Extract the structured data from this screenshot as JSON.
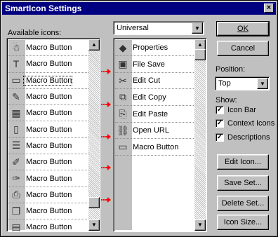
{
  "window": {
    "title": "SmartIcon Settings",
    "close_glyph": "×"
  },
  "available": {
    "label": "Available icons:",
    "items": [
      {
        "icon": "macro-figure-icon",
        "label": "Macro Button"
      },
      {
        "icon": "macro-text-icon",
        "label": "Macro Button"
      },
      {
        "icon": "macro-window-icon",
        "label": "Macro Button"
      },
      {
        "icon": "macro-pen-icon",
        "label": "Macro Button"
      },
      {
        "icon": "macro-grid-icon",
        "label": "Macro Button"
      },
      {
        "icon": "macro-page-icon",
        "label": "Macro Button"
      },
      {
        "icon": "macro-lines-icon",
        "label": "Macro Button"
      },
      {
        "icon": "macro-brush-icon",
        "label": "Macro Button"
      },
      {
        "icon": "macro-brush2-icon",
        "label": "Macro Button"
      },
      {
        "icon": "macro-printer-icon",
        "label": "Macro Button"
      },
      {
        "icon": "macro-copies-icon",
        "label": "Macro Button"
      },
      {
        "icon": "macro-doc-icon",
        "label": "Macro Button"
      }
    ]
  },
  "set_dropdown": {
    "value": "Universal"
  },
  "current": {
    "items": [
      {
        "icon": "properties-icon",
        "label": "Properties"
      },
      {
        "icon": "file-save-icon",
        "label": "File Save"
      },
      {
        "icon": "scissors-icon",
        "label": "Edit Cut"
      },
      {
        "icon": "copy-icon",
        "label": "Edit Copy"
      },
      {
        "icon": "paste-icon",
        "label": "Edit Paste"
      },
      {
        "icon": "url-icon",
        "label": "Open URL"
      },
      {
        "icon": "macro-button-icon",
        "label": "Macro Button"
      }
    ]
  },
  "buttons": {
    "ok": "OK",
    "cancel": "Cancel",
    "edit_icon": "Edit Icon...",
    "save_set": "Save Set...",
    "delete_set": "Delete Set...",
    "icon_size": "Icon Size..."
  },
  "position": {
    "label": "Position:",
    "value": "Top"
  },
  "show": {
    "label": "Show:",
    "options": [
      {
        "label": "Icon Bar",
        "checked": true
      },
      {
        "label": "Context Icons",
        "checked": true
      },
      {
        "label": "Descriptions",
        "checked": true
      }
    ]
  },
  "colors": {
    "titlebar": "#000080",
    "dialog_face": "#c0c0c0",
    "arrow": "#ff0000"
  }
}
